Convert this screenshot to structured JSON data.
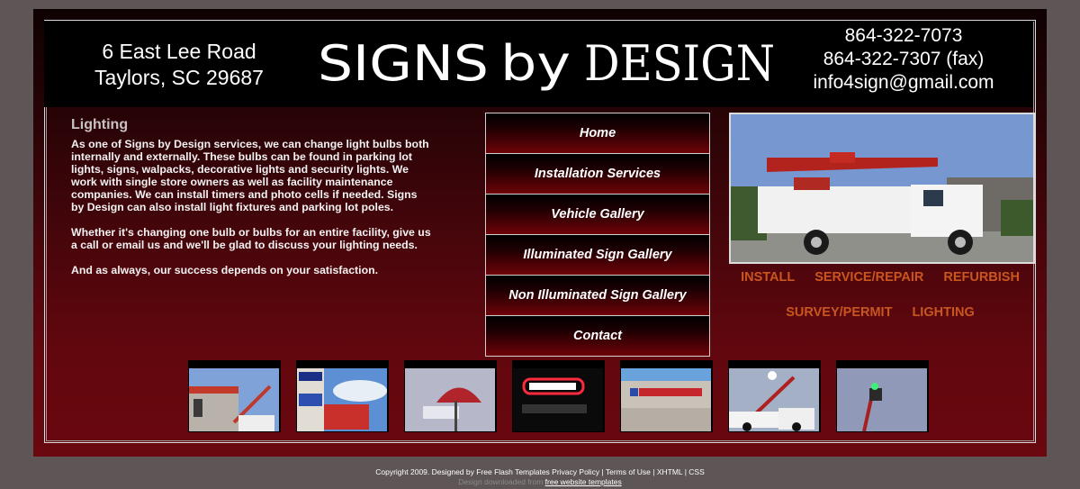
{
  "header": {
    "address_line1": "6 East Lee Road",
    "address_line2": "Taylors, SC 29687",
    "logo_text": "SIGNS by DESIGN",
    "phone": "864-322-7073",
    "fax": "864-322-7307 (fax)",
    "email": "info4sign@gmail.com"
  },
  "content": {
    "heading": "Lighting",
    "paragraphs": [
      "As one of Signs by Design services, we can change light bulbs both internally and externally.   These bulbs can be found in parking lot lights, signs, walpacks, decorative lights and security lights.   We work with single store owners as well as facility maintenance companies.   We can install timers and photo cells if needed.   Signs by Design can also install light fixtures and parking lot poles.",
      "Whether it's changing one bulb or bulbs for an entire facility, give us a call or email us and we'll be glad to discuss your lighting needs.",
      "And as always, our success depends on your satisfaction."
    ]
  },
  "nav": {
    "items": [
      {
        "label": "Home"
      },
      {
        "label": "Installation Services"
      },
      {
        "label": "Vehicle Gallery"
      },
      {
        "label": "Illuminated Sign Gallery"
      },
      {
        "label": "Non Illuminated Sign Gallery"
      },
      {
        "label": "Contact"
      }
    ]
  },
  "services": {
    "row1": [
      "INSTALL",
      "SERVICE/REPAIR",
      "REFURBISH"
    ],
    "row2": [
      "SURVEY/PERMIT",
      "LIGHTING"
    ]
  },
  "thumbnails": [
    "building-with-bucket-truck",
    "pole-sign-with-lift",
    "car-wash-sign",
    "neon-sign-night",
    "storefront-sign",
    "bucket-trucks-pole",
    "lift-at-pole-top"
  ],
  "footer": {
    "line1": "Copyright 2009. Designed by Free Flash Templates Privacy Policy | Terms of Use | XHTML | CSS",
    "line2_text": "Design downloaded from",
    "line2_link": "free website templates"
  },
  "colors": {
    "background": "#5d5556",
    "accent_orange": "#c95621",
    "frame_dark_red": "#6a070f"
  }
}
